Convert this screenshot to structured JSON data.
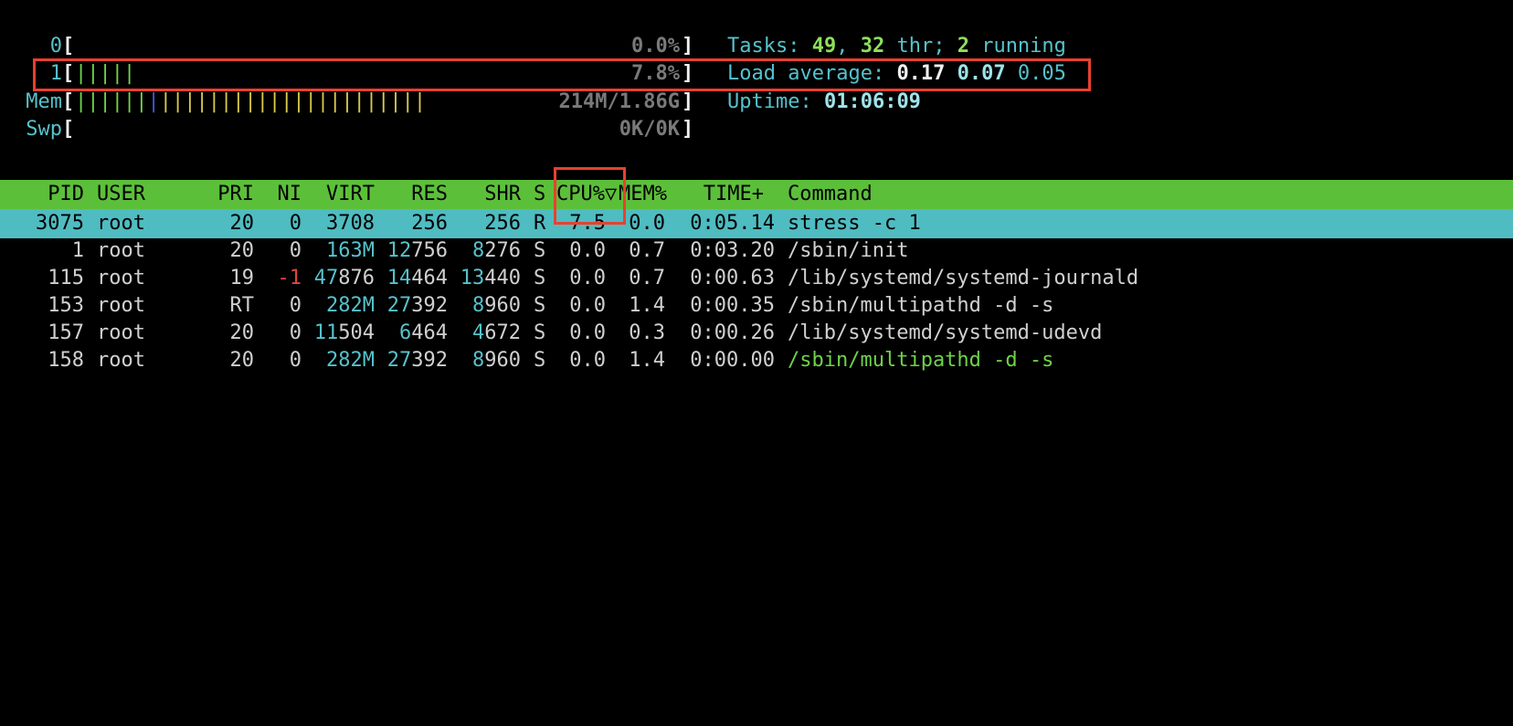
{
  "meters": {
    "cpu0": {
      "label": "0",
      "bar": "",
      "value": "0.0%",
      "usage_pct": 0.0
    },
    "cpu1": {
      "label": "1",
      "bar": "|||||",
      "value": "7.8%",
      "usage_pct": 7.8
    },
    "mem": {
      "label": "Mem",
      "bar_green": "||||||",
      "bar_blue": "|",
      "bar_yellow": "||||||||||||||||||||||",
      "value": "214M/1.86G"
    },
    "swp": {
      "label": "Swp",
      "bar": "",
      "value": "0K/0K"
    },
    "lbracket": "[",
    "rbracket": "]"
  },
  "summary": {
    "tasks_label": "Tasks: ",
    "tasks_count": "49",
    "tasks_sep": ", ",
    "threads_count": "32",
    "threads_label": " thr; ",
    "running_count": "2",
    "running_label": " running",
    "load_label": "Load average: ",
    "load1": "0.17",
    "load5": "0.07",
    "load15": "0.05",
    "uptime_label": "Uptime: ",
    "uptime": "01:06:09"
  },
  "columns": {
    "pid": "PID",
    "user": "USER",
    "pri": "PRI",
    "ni": "NI",
    "virt": "VIRT",
    "res": "RES",
    "shr": "SHR",
    "s": "S",
    "cpu": "CPU%▽",
    "mem": "MEM%",
    "time": "TIME+",
    "command": "Command"
  },
  "processes": [
    {
      "pid": "3075",
      "user": "root",
      "pri": "20",
      "ni": "0",
      "virt": "3708",
      "res": "256",
      "shr": "256",
      "s": "R",
      "cpu": "7.5",
      "mem": "0.0",
      "time": "0:05.14",
      "command": "stress -c 1"
    },
    {
      "pid": "1",
      "user": "root",
      "pri": "20",
      "ni": "0",
      "virt": "163M",
      "res_hi": "12",
      "res_lo": "756",
      "shr_hi": "8",
      "shr_lo": "276",
      "s": "S",
      "cpu": "0.0",
      "mem": "0.7",
      "time": "0:03.20",
      "command": "/sbin/init"
    },
    {
      "pid": "115",
      "user": "root",
      "pri": "19",
      "ni": "-1",
      "virt_hi": "47",
      "virt_lo": "876",
      "res_hi": "14",
      "res_lo": "464",
      "shr_hi": "13",
      "shr_lo": "440",
      "s": "S",
      "cpu": "0.0",
      "mem": "0.7",
      "time": "0:00.63",
      "command": "/lib/systemd/systemd-journald"
    },
    {
      "pid": "153",
      "user": "root",
      "pri": "RT",
      "ni": "0",
      "virt": "282M",
      "res_hi": "27",
      "res_lo": "392",
      "shr_hi": "8",
      "shr_lo": "960",
      "s": "S",
      "cpu": "0.0",
      "mem": "1.4",
      "time": "0:00.35",
      "command": "/sbin/multipathd -d -s"
    },
    {
      "pid": "157",
      "user": "root",
      "pri": "20",
      "ni": "0",
      "virt_hi": "11",
      "virt_lo": "504",
      "res_hi": "6",
      "res_lo": "464",
      "shr_hi": "4",
      "shr_lo": "672",
      "s": "S",
      "cpu": "0.0",
      "mem": "0.3",
      "time": "0:00.26",
      "command": "/lib/systemd/systemd-udevd"
    },
    {
      "pid": "158",
      "user": "root",
      "pri": "20",
      "ni": "0",
      "virt": "282M",
      "res_hi": "27",
      "res_lo": "392",
      "shr_hi": "8",
      "shr_lo": "960",
      "s": "S",
      "cpu": "0.0",
      "mem": "1.4",
      "time": "0:00.00",
      "command": "/sbin/multipathd -d -s"
    }
  ],
  "colors": {
    "header_bg": "#5cbf3a",
    "selected_bg": "#4fbcc1",
    "highlight": "#e8412f",
    "cyan": "#56c2cc"
  }
}
